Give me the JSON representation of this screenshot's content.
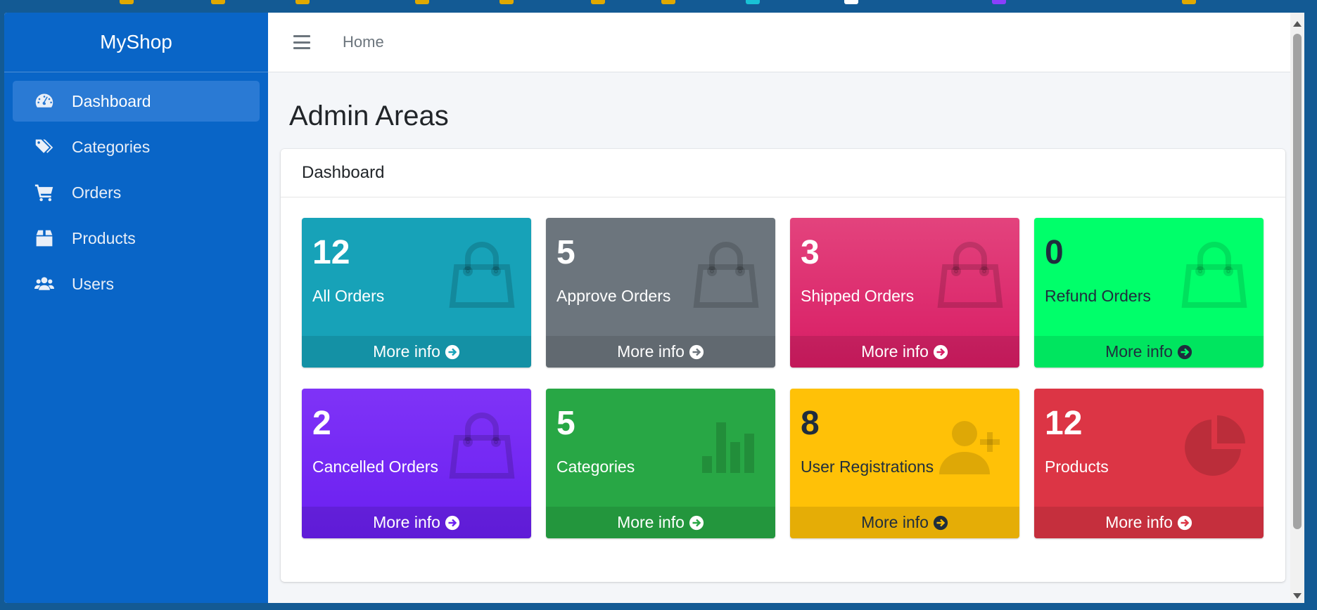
{
  "sidebar": {
    "brand": "MyShop",
    "items": [
      {
        "label": "Dashboard",
        "icon": "tachometer-icon",
        "active": true
      },
      {
        "label": "Categories",
        "icon": "tags-icon"
      },
      {
        "label": "Orders",
        "icon": "cart-icon"
      },
      {
        "label": "Products",
        "icon": "box-icon"
      },
      {
        "label": "Users",
        "icon": "users-icon"
      }
    ]
  },
  "topbar": {
    "menu_icon": "hamburger-icon",
    "home_label": "Home"
  },
  "page": {
    "title": "Admin Areas",
    "card_title": "Dashboard"
  },
  "boxes": [
    {
      "value": "12",
      "label": "All Orders",
      "link": "More info",
      "color": "#17a2b8",
      "icon": "shopping-bag-icon"
    },
    {
      "value": "5",
      "label": "Approve Orders",
      "link": "More info",
      "color": "#6c757d",
      "icon": "shopping-bag-icon"
    },
    {
      "value": "3",
      "label": "Shipped Orders",
      "link": "More info",
      "color": "#e83e8c",
      "icon": "shopping-bag-icon"
    },
    {
      "value": "0",
      "label": "Refund Orders",
      "link": "More info",
      "color": "#00ff6a",
      "icon": "shopping-bag-icon"
    },
    {
      "value": "2",
      "label": "Cancelled Orders",
      "link": "More info",
      "color": "#7a2cf7",
      "icon": "shopping-bag-icon"
    },
    {
      "value": "5",
      "label": "Categories",
      "link": "More info",
      "color": "#28a745",
      "icon": "bar-chart-icon"
    },
    {
      "value": "8",
      "label": "User Registrations",
      "link": "More info",
      "color": "#ffc107",
      "icon": "user-plus-icon"
    },
    {
      "value": "12",
      "label": "Products",
      "link": "More info",
      "color": "#dc3545",
      "icon": "pie-chart-icon"
    }
  ]
}
